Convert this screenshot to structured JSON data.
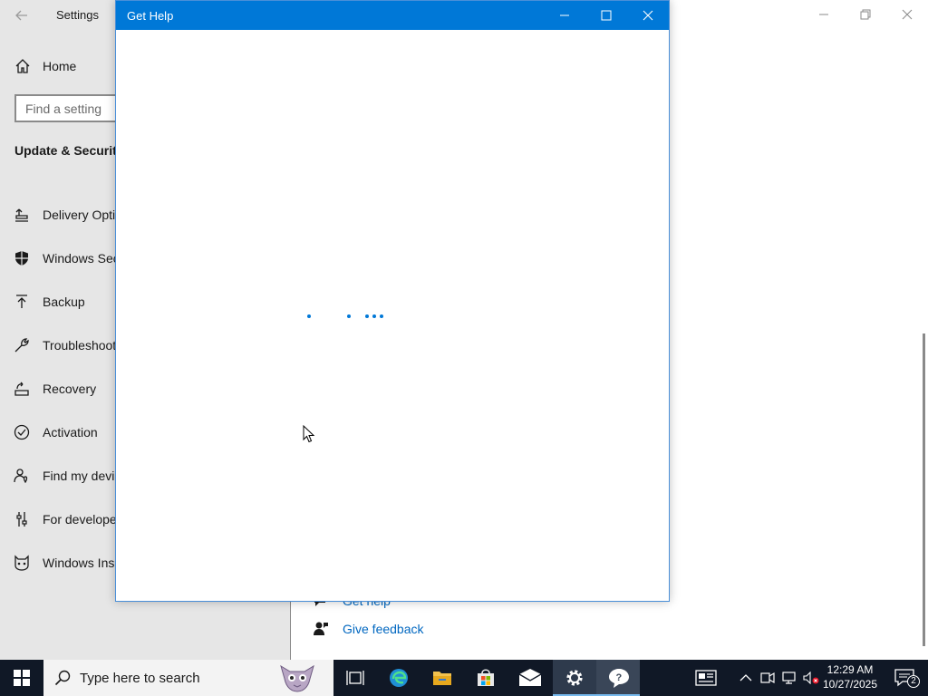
{
  "settings": {
    "title": "Settings",
    "home_label": "Home",
    "search_placeholder": "Find a setting",
    "section_title": "Update & Security",
    "nav_items": [
      {
        "label": "Delivery Optimization",
        "icon": "delivery-optimization-icon"
      },
      {
        "label": "Windows Security",
        "icon": "shield-icon"
      },
      {
        "label": "Backup",
        "icon": "backup-arrow-icon"
      },
      {
        "label": "Troubleshoot",
        "icon": "wrench-icon"
      },
      {
        "label": "Recovery",
        "icon": "recovery-icon"
      },
      {
        "label": "Activation",
        "icon": "checkmark-circle-icon"
      },
      {
        "label": "Find my device",
        "icon": "person-location-icon"
      },
      {
        "label": "For developers",
        "icon": "developer-sliders-icon"
      },
      {
        "label": "Windows Insider Program",
        "icon": "insider-cat-icon"
      }
    ],
    "related_links": [
      {
        "label": "Get help",
        "icon": "help-chat-icon"
      },
      {
        "label": "Give feedback",
        "icon": "feedback-person-icon"
      }
    ]
  },
  "gethelp": {
    "title": "Get Help",
    "loading_state": "loading-dots",
    "accent": "#0078d7"
  },
  "taskbar": {
    "search_placeholder": "Type here to search",
    "apps": [
      "task-view-icon",
      "edge-icon",
      "file-explorer-icon",
      "store-icon",
      "mail-icon",
      "settings-gear-icon",
      "get-help-icon"
    ],
    "active_apps": [
      "settings-gear-icon",
      "get-help-icon"
    ],
    "clock_time": "12:29 AM",
    "clock_date": "10/27/2025",
    "notification_count": "2"
  },
  "colors": {
    "titlebar": "#0078d7",
    "taskbar": "#101826",
    "sidebar": "#e6e6e6",
    "link": "#0067c0"
  }
}
